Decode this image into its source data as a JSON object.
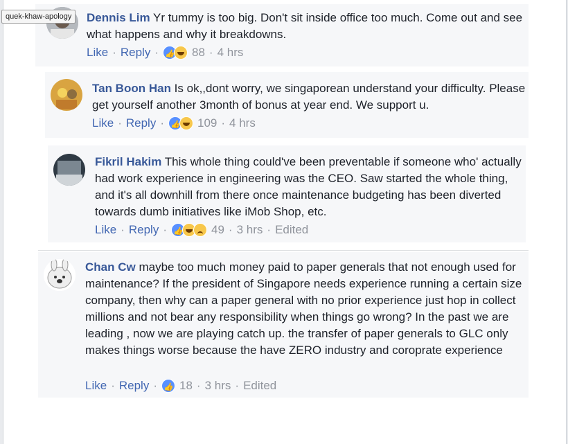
{
  "tag": "quek-khaw-apology",
  "comments": [
    {
      "author": "Dennis Lim",
      "text": " Yr tummy is too big. Don't sit inside office too much. Come out and see what happens and why it breakdowns.",
      "like_label": "Like",
      "reply_label": "Reply",
      "reaction_count": "88",
      "time": "4 hrs",
      "reactions": [
        "like-icon",
        "haha-icon"
      ]
    },
    {
      "author": "Tan Boon Han",
      "text": " Is ok,,dont worry, we singaporean understand your difficulty. Please get yourself another 3month of bonus at year end. We support u.",
      "like_label": "Like",
      "reply_label": "Reply",
      "reaction_count": "109",
      "time": "4 hrs",
      "reactions": [
        "like-icon",
        "haha-icon"
      ]
    },
    {
      "author": "Fikril Hakim",
      "text": " This whole thing could've been preventable if someone who' actually had work experience in engineering was the CEO. Saw started the whole thing, and it's all downhill from there once maintenance budgeting has been diverted towards dumb initiatives like iMob Shop, etc.",
      "like_label": "Like",
      "reply_label": "Reply",
      "reaction_count": "49",
      "time": "3 hrs",
      "edited": "Edited",
      "reactions": [
        "like-icon",
        "haha-icon",
        "sad-icon"
      ]
    },
    {
      "author": "Chan Cw",
      "text": " maybe too much money paid to paper generals that not enough used for maintenance? If the president of Singapore needs experience running a certain size company, then why can a paper general with no prior experience just hop in collect millions and not bear any responsibility when things go wrong? In the past we are leading , now we are playing catch up. the transfer of paper generals to GLC only makes things worse because the have ZERO industry and coroprate experience",
      "like_label": "Like",
      "reply_label": "Reply",
      "reaction_count": "18",
      "time": "3 hrs",
      "edited": "Edited",
      "reactions": [
        "like-icon"
      ]
    }
  ],
  "colors": {
    "name": "#385898",
    "link": "#4267b2",
    "meta": "#90949c",
    "bubble": "#f6f7f9"
  }
}
